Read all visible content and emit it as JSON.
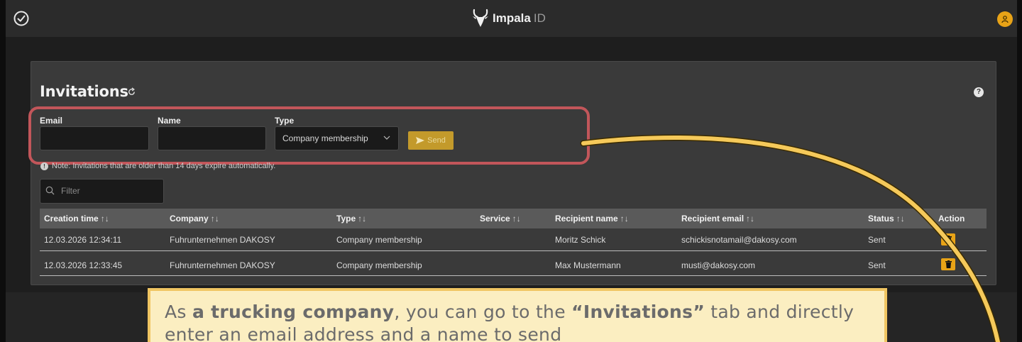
{
  "brand": {
    "name": "Impala",
    "suffix": "ID"
  },
  "page": {
    "title": "Invitations"
  },
  "form": {
    "email_label": "Email",
    "name_label": "Name",
    "type_label": "Type",
    "type_value": "Company membership",
    "send_label": "Send"
  },
  "note": "Note: Invitations that are older than 14 days expire automatically.",
  "filter": {
    "placeholder": "Filter"
  },
  "table": {
    "columns": [
      "Creation time",
      "Company",
      "Type",
      "Service",
      "Recipient name",
      "Recipient email",
      "Status",
      "Action"
    ],
    "sort_glyph": "↑↓",
    "rows": [
      {
        "creation_time": "12.03.2026 12:34:11",
        "company": "Fuhrunternehmen DAKOSY",
        "type": "Company membership",
        "service": "",
        "recipient_name": "Moritz Schick",
        "recipient_email": "schickisnotamail@dakosy.com",
        "status": "Sent"
      },
      {
        "creation_time": "12.03.2026 12:33:45",
        "company": "Fuhrunternehmen DAKOSY",
        "type": "Company membership",
        "service": "",
        "recipient_name": "Max Mustermann",
        "recipient_email": "musti@dakosy.com",
        "status": "Sent"
      }
    ]
  },
  "callout": {
    "part1": "As ",
    "bold1": "a trucking company",
    "part2": ", you can go to the ",
    "bold2": "“Invitations”",
    "part3": " tab and directly enter an email address and a name to send"
  },
  "icons": {
    "app": "check-circle-icon",
    "refresh": "refresh-icon",
    "help": "help-icon",
    "filter": "search-icon",
    "delete": "trash-icon",
    "avatar": "user-icon"
  },
  "colors": {
    "accent": "#e8a317",
    "highlight_border": "#c2565a",
    "callout_bg": "#fbeec1",
    "callout_border": "#f0c562",
    "arrow": "#f5c95a"
  }
}
